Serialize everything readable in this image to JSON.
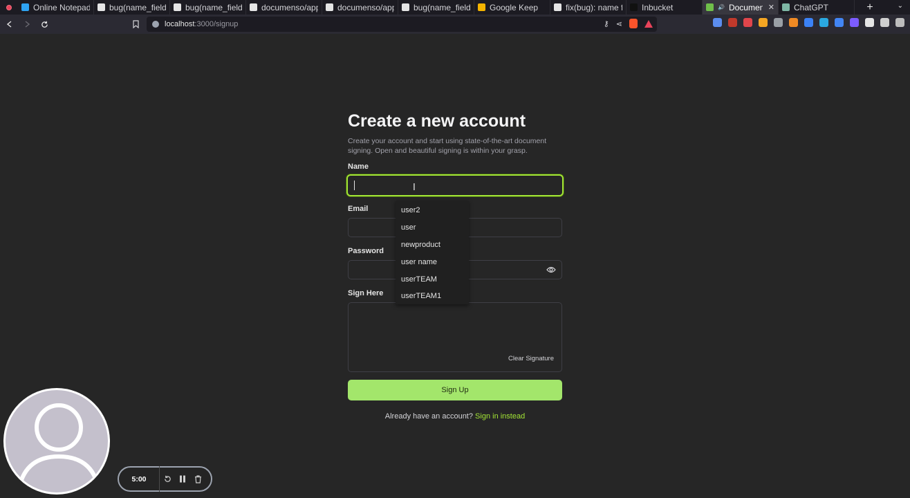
{
  "browser": {
    "tabs": [
      {
        "title": "Online Notepad",
        "favicon_color": "#2ea3f2",
        "active": false
      },
      {
        "title": "bug(name_field):",
        "favicon_color": "#e5e5e5",
        "active": false
      },
      {
        "title": "bug(name_field):",
        "favicon_color": "#e5e5e5",
        "active": false
      },
      {
        "title": "documenso/apps/",
        "favicon_color": "#e5e5e5",
        "active": false
      },
      {
        "title": "documenso/apps/",
        "favicon_color": "#e5e5e5",
        "active": false
      },
      {
        "title": "bug(name_field):",
        "favicon_color": "#e5e5e5",
        "active": false
      },
      {
        "title": "Google Keep",
        "favicon_color": "#f5b400",
        "active": false
      },
      {
        "title": "fix(bug): name fie",
        "favicon_color": "#e5e5e5",
        "active": false
      },
      {
        "title": "Inbucket",
        "favicon_color": "#111111",
        "active": false
      },
      {
        "title": "Documenso",
        "favicon_color": "#6fbf4a",
        "active": true
      },
      {
        "title": "ChatGPT",
        "favicon_color": "#7fb8a6",
        "active": false
      }
    ],
    "url_host": "localhost",
    "url_path": ":3000/signup"
  },
  "form": {
    "heading": "Create a new account",
    "subtitle": "Create your account and start using state-of-the-art document signing. Open and beautiful signing is within your grasp.",
    "name_label": "Name",
    "name_value": "",
    "email_label": "Email",
    "password_label": "Password",
    "sign_label": "Sign Here",
    "clear_signature": "Clear Signature",
    "submit_label": "Sign Up",
    "footer_text": "Already have an account?",
    "footer_link": "Sign in instead",
    "accent_color": "#a3e635"
  },
  "autocomplete": {
    "options": [
      "user2",
      "user",
      "newproduct",
      "user name",
      "userTEAM",
      "userTEAM1"
    ]
  },
  "recorder": {
    "time": "5:00"
  }
}
